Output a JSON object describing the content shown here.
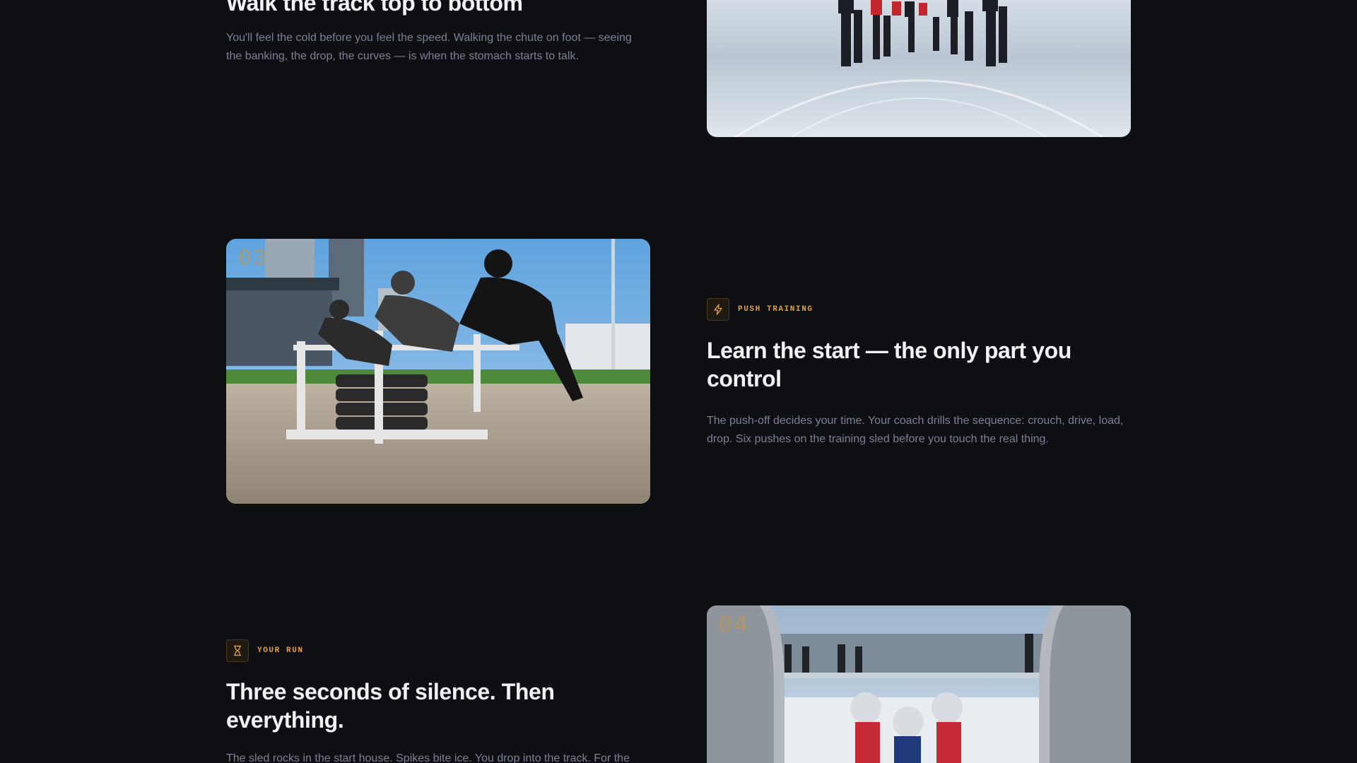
{
  "sections": [
    {
      "title": "Walk the track top to bottom",
      "body": "You'll feel the cold before you feel the speed. Walking the chute on foot — seeing the banking, the drop, the curves — is when the stomach starts to talk."
    },
    {
      "number": "03",
      "label": "PUSH TRAINING",
      "icon": "lightning-bolt-icon",
      "title": "Learn the start — the only part you control",
      "body": "The push-off decides your time. Your coach drills the sequence: crouch, drive, load, drop. Six pushes on the training sled before you touch the real thing."
    },
    {
      "number": "04",
      "label": "YOUR RUN",
      "icon": "hourglass-icon",
      "title": "Three seconds of silence. Then everything.",
      "body": "The sled rocks in the start house. Spikes bite ice. You drop into the track. For the"
    }
  ],
  "colors": {
    "background": "#0d0f13",
    "accent": "#e3a23d",
    "heading": "#f1f3f6",
    "body": "#7b8190"
  }
}
